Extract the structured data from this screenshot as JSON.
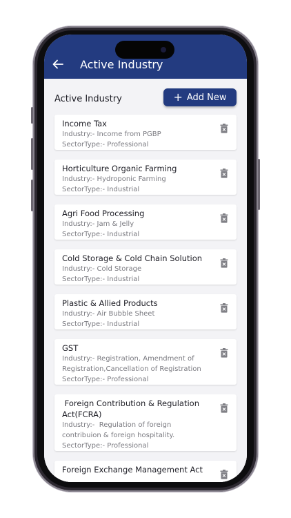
{
  "appbar": {
    "title": "Active Industry",
    "back_icon": "arrow-left-icon"
  },
  "section": {
    "title": "Active Industry",
    "add_label": "Add New",
    "add_icon": "plus-icon"
  },
  "colors": {
    "primary": "#233b80",
    "background": "#f3f3f6",
    "card": "#ffffff",
    "muted_text": "#7a7a80"
  },
  "industries": [
    {
      "name": "Income Tax",
      "industry": "Industry:- Income from PGBP",
      "sector": "SectorType:- Professional"
    },
    {
      "name": "Horticulture Organic Farming",
      "industry": "Industry:- Hydroponic Farming",
      "sector": "SectorType:- Industrial"
    },
    {
      "name": "Agri Food Processing",
      "industry": "Industry:- Jam & Jelly",
      "sector": "SectorType:- Industrial"
    },
    {
      "name": "Cold Storage & Cold Chain Solution",
      "industry": "Industry:- Cold Storage",
      "sector": "SectorType:- Industrial"
    },
    {
      "name": "Plastic & Allied Products",
      "industry": "Industry:- Air Bubble Sheet",
      "sector": "SectorType:- Industrial"
    },
    {
      "name": "GST",
      "industry": "Industry:- Registration, Amendment of Registration,Cancellation of Registration",
      "sector": "SectorType:- Professional"
    },
    {
      "name": " Foreign Contribution & Regulation Act(FCRA)",
      "industry": "Industry:-  Regulation of foreign contribuion & foreign hospitality.",
      "sector": "SectorType:- Professional"
    },
    {
      "name": "Foreign Exchange Management Act",
      "industry": "",
      "sector": ""
    }
  ]
}
